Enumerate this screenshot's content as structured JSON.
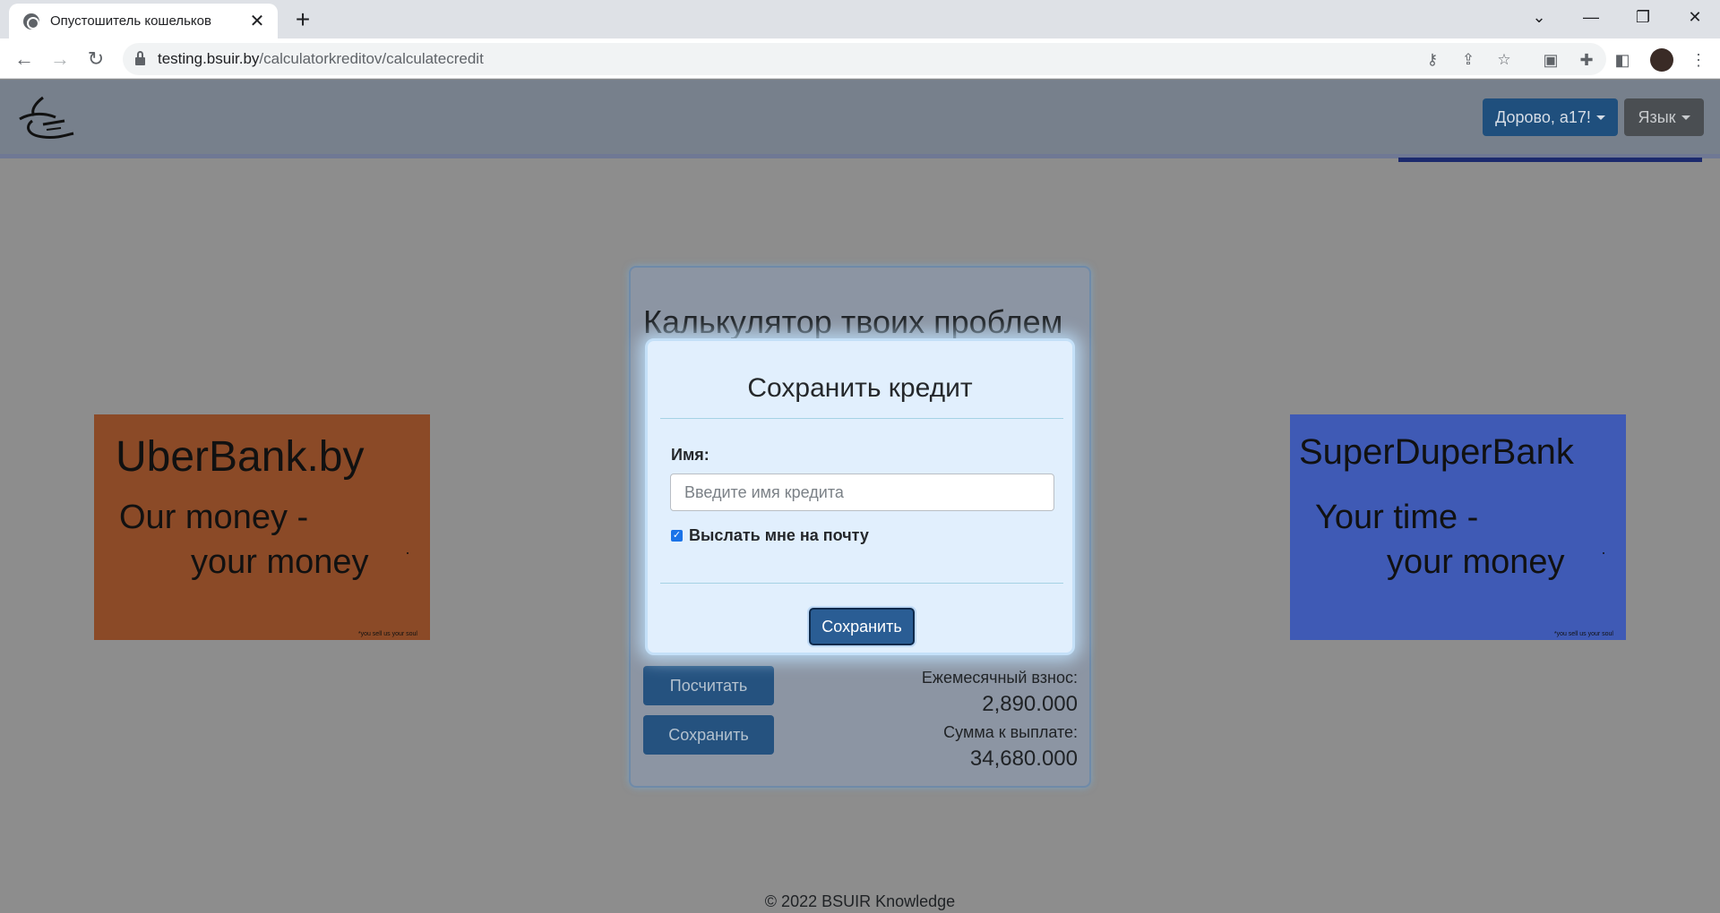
{
  "browser": {
    "tab_title": "Опустошитель кошельков",
    "tab_close": "✕",
    "new_tab": "+",
    "url_host": "testing.bsuir.by",
    "url_path": "/calculatorkreditov/calculatecredit",
    "window_controls": [
      "chevron-down-icon",
      "minimize-icon",
      "restore-icon",
      "close-icon"
    ]
  },
  "header": {
    "greeting": "Дорово, a17!",
    "language": "Язык"
  },
  "ads": {
    "left": {
      "name": "UberBank.by",
      "line1": "Our money -",
      "line2": "your money",
      "small": "*you sell us your soul",
      "color": "#8b4a27"
    },
    "right": {
      "name": "SuperDuperBank",
      "line1": "Your time -",
      "line2": "your money",
      "small": "*you sell us your soul",
      "color": "#3f5ab5"
    }
  },
  "calculator": {
    "title": "Калькулятор твоих проблем",
    "calculate_label": "Посчитать",
    "save_label": "Сохранить",
    "monthly_label": "Ежемесячный взнос:",
    "monthly_value": "2,890.000",
    "total_label": "Сумма к выплате:",
    "total_value": "34,680.000"
  },
  "modal": {
    "title": "Сохранить кредит",
    "name_label": "Имя:",
    "name_placeholder": "Введите имя кредита",
    "name_value": "",
    "email_checkbox_label": "Выслать мне на почту",
    "email_checked": true,
    "save_label": "Сохранить"
  },
  "footer": {
    "text": "© 2022 BSUIR Knowledge"
  }
}
